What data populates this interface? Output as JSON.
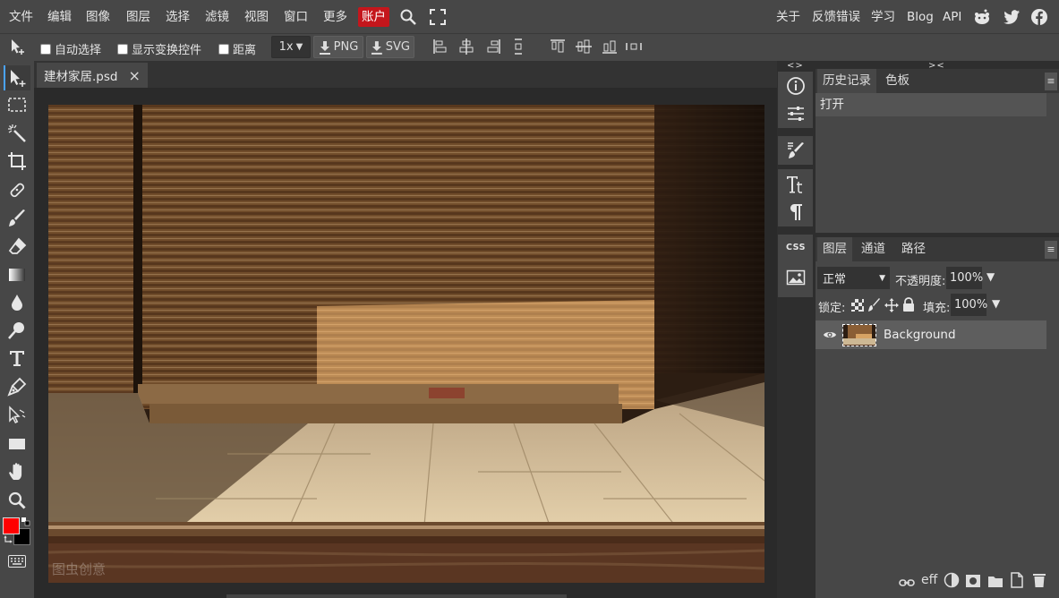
{
  "menu": {
    "items": [
      "文件",
      "编辑",
      "图像",
      "图层",
      "选择",
      "滤镜",
      "视图",
      "窗口",
      "更多"
    ],
    "account": "账户",
    "right_links": [
      "关于",
      "反馈错误",
      "学习",
      "Blog",
      "API"
    ]
  },
  "options": {
    "auto_select": "自动选择",
    "show_transform": "显示变换控件",
    "distance": "距离",
    "zoom": "1x",
    "png": "PNG",
    "svg": "SVG"
  },
  "document": {
    "tab_name": "建材家居.psd",
    "close": "×",
    "watermark": "图虫创意"
  },
  "midcol": {
    "collapse": "<>",
    "css": "CSS"
  },
  "history_panel": {
    "tabs": [
      "历史记录",
      "色板"
    ],
    "expand": "><",
    "menu": "≡",
    "rows": [
      "打开"
    ]
  },
  "layers_panel": {
    "tabs": [
      "图层",
      "通道",
      "路径"
    ],
    "menu": "≡",
    "blend_mode": "正常",
    "opacity_label": "不透明度:",
    "opacity_value": "100%",
    "lock_label": "锁定:",
    "fill_label": "填充:",
    "fill_value": "100%",
    "layers": [
      {
        "name": "Background"
      }
    ],
    "bottom_text": "eff"
  },
  "colors": {
    "foreground": "#ff0000",
    "background": "#000000",
    "accent": "#c4161c"
  }
}
